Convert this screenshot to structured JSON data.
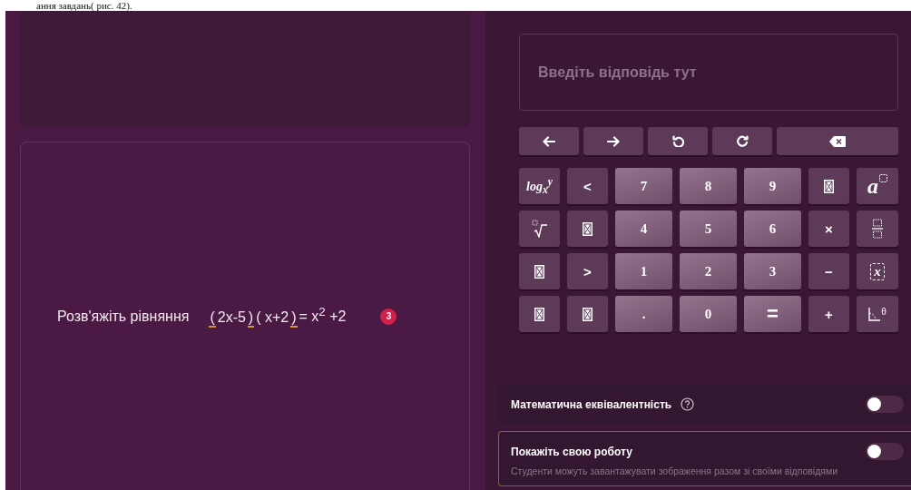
{
  "caption": "ання завдань( рис. 42).",
  "question": {
    "text": "Розв'яжіть рівняння",
    "equation": [
      {
        "kind": "blank",
        "text": "("
      },
      {
        "kind": "plain",
        "text": "2x-5"
      },
      {
        "kind": "blank",
        "text": ")"
      },
      {
        "kind": "plain",
        "text": "( x+2"
      },
      {
        "kind": "blank",
        "text": ")"
      },
      {
        "kind": "plain",
        "text": "= x$^{2}$ +2"
      }
    ],
    "badge": "3"
  },
  "answer": {
    "placeholder": "Введіть відповідь тут"
  },
  "nav_keys": [
    {
      "kind": "left"
    },
    {
      "kind": "right"
    },
    {
      "kind": "undo"
    },
    {
      "kind": "redo"
    },
    {
      "kind": "backspace"
    }
  ],
  "keys": [
    {
      "kind": "serif",
      "label": "log$_{x}$$^{y}$"
    },
    {
      "kind": "op",
      "label": "<"
    },
    {
      "kind": "digit",
      "label": "7"
    },
    {
      "kind": "digit",
      "label": "8"
    },
    {
      "kind": "digit",
      "label": "9"
    },
    {
      "kind": "missing"
    },
    {
      "kind": "power",
      "label": "a"
    },
    {
      "kind": "root"
    },
    {
      "kind": "missing"
    },
    {
      "kind": "digit",
      "label": "4"
    },
    {
      "kind": "digit",
      "label": "5"
    },
    {
      "kind": "digit",
      "label": "6"
    },
    {
      "kind": "op",
      "label": "×"
    },
    {
      "kind": "fraction"
    },
    {
      "kind": "missing"
    },
    {
      "kind": "op",
      "label": ">"
    },
    {
      "kind": "digit",
      "label": "1"
    },
    {
      "kind": "digit",
      "label": "2"
    },
    {
      "kind": "digit",
      "label": "3"
    },
    {
      "kind": "op",
      "label": "−"
    },
    {
      "kind": "boxed",
      "label": "x"
    },
    {
      "kind": "missing"
    },
    {
      "kind": "missing"
    },
    {
      "kind": "digit",
      "label": "."
    },
    {
      "kind": "digit",
      "label": "0"
    },
    {
      "kind": "bigop",
      "label": "="
    },
    {
      "kind": "op",
      "label": "+"
    },
    {
      "kind": "angle",
      "label": "θ"
    }
  ],
  "settings": [
    {
      "title": "Математична еквівалентність",
      "help": true,
      "on": false,
      "highlighted": false
    },
    {
      "title": "Покажіть свою роботу",
      "description": "Студенти можуть завантажувати зображення разом зі своїми відповідями",
      "on": false,
      "highlighted": true
    }
  ]
}
